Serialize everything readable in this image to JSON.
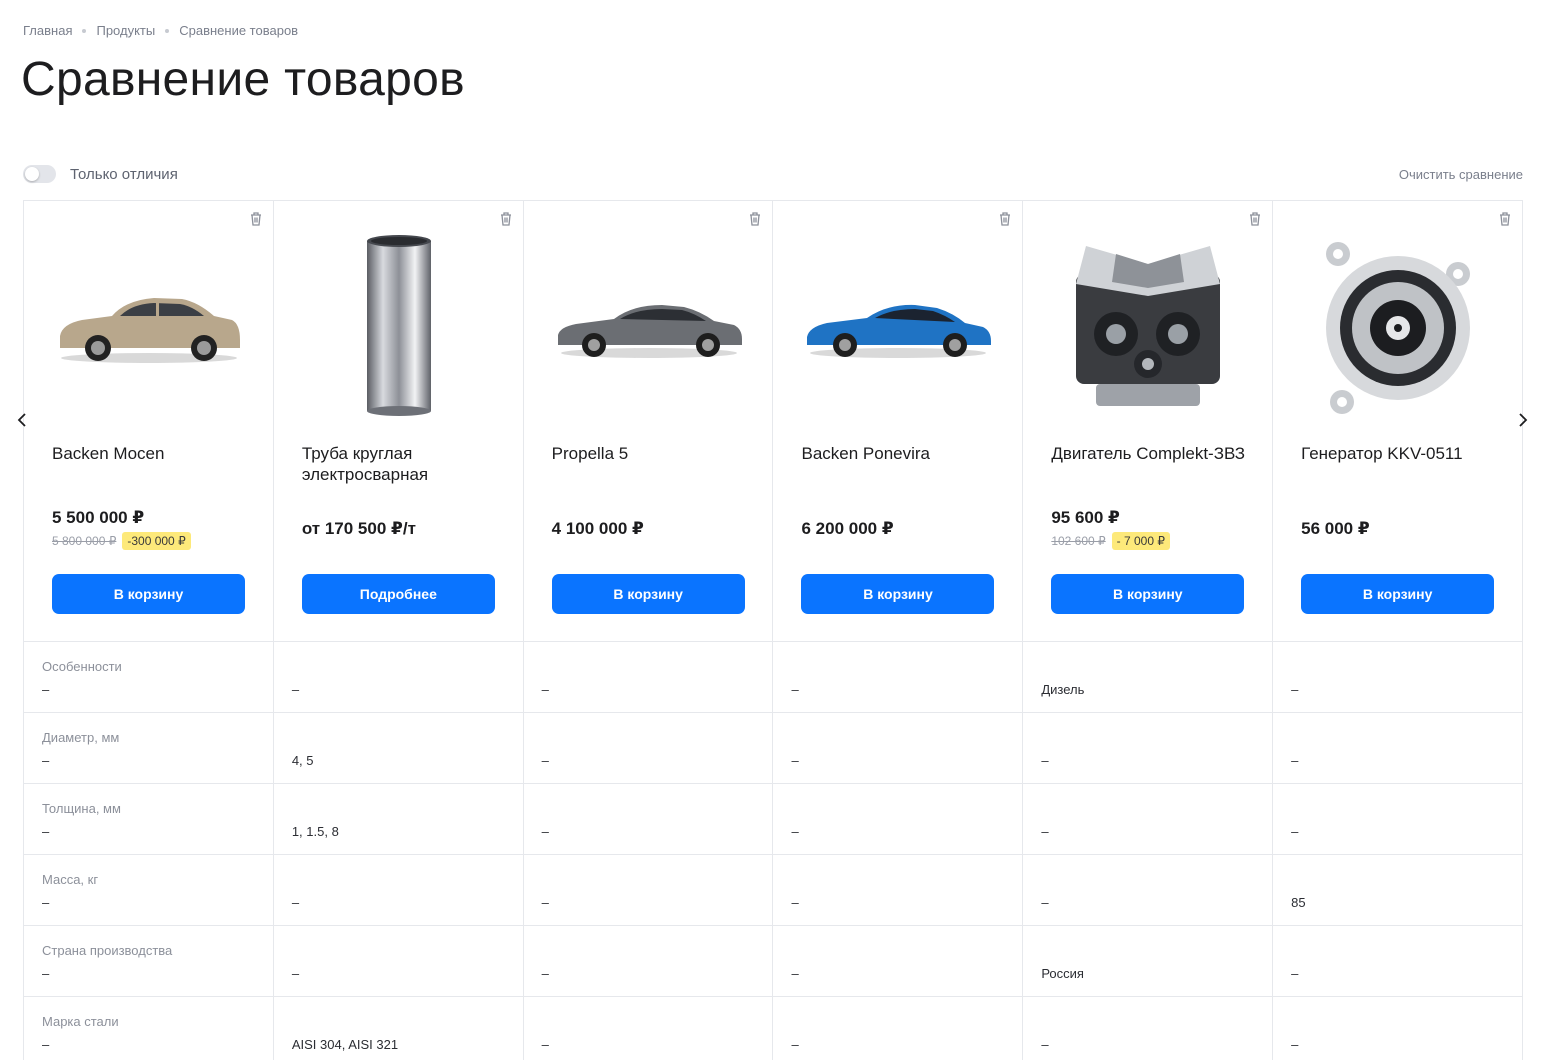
{
  "breadcrumb": [
    "Главная",
    "Продукты",
    "Сравнение товаров"
  ],
  "title": "Сравнение товаров",
  "toolbar": {
    "toggle_label": "Только отличия",
    "toggle_on": false,
    "clear_label": "Очистить сравнение"
  },
  "colors": {
    "accent": "#0a74ff",
    "discount_bg": "#fde97a",
    "border": "#e6e8ec"
  },
  "products": [
    {
      "name": "Backen Mocen",
      "image": "car-suv-beige",
      "price": "5 500 000 ₽",
      "old_price": "5 800 000 ₽",
      "discount": "-300 000 ₽",
      "button": "В корзину"
    },
    {
      "name": "Труба круглая электросварная",
      "image": "steel-pipe",
      "price": "от 170 500 ₽/т",
      "old_price": null,
      "discount": null,
      "button": "Подробнее"
    },
    {
      "name": "Propella 5",
      "image": "car-sedan-gray",
      "price": "4 100 000 ₽",
      "old_price": null,
      "discount": null,
      "button": "В корзину"
    },
    {
      "name": "Backen Ponevira",
      "image": "car-sedan-blue",
      "price": "6 200 000 ₽",
      "old_price": null,
      "discount": null,
      "button": "В корзину"
    },
    {
      "name": "Двигатель Complekt-ЗВЗ",
      "image": "engine",
      "price": "95 600 ₽",
      "old_price": "102 600 ₽",
      "discount": "- 7 000 ₽",
      "button": "В корзину"
    },
    {
      "name": "Генератор KKV-0511",
      "image": "alternator",
      "price": "56 000 ₽",
      "old_price": null,
      "discount": null,
      "button": "В корзину"
    }
  ],
  "specs": [
    {
      "label": "Особенности",
      "values": [
        "–",
        "–",
        "–",
        "–",
        "Дизель",
        "–"
      ]
    },
    {
      "label": "Диаметр, мм",
      "values": [
        "–",
        "4, 5",
        "–",
        "–",
        "–",
        "–"
      ]
    },
    {
      "label": "Толщина, мм",
      "values": [
        "–",
        "1, 1.5, 8",
        "–",
        "–",
        "–",
        "–"
      ]
    },
    {
      "label": "Масса, кг",
      "values": [
        "–",
        "–",
        "–",
        "–",
        "–",
        "85"
      ]
    },
    {
      "label": "Страна производства",
      "values": [
        "–",
        "–",
        "–",
        "–",
        "Россия",
        "–"
      ]
    },
    {
      "label": "Марка стали",
      "values": [
        "–",
        "AISI 304, AISI 321",
        "–",
        "–",
        "–",
        "–"
      ]
    }
  ]
}
